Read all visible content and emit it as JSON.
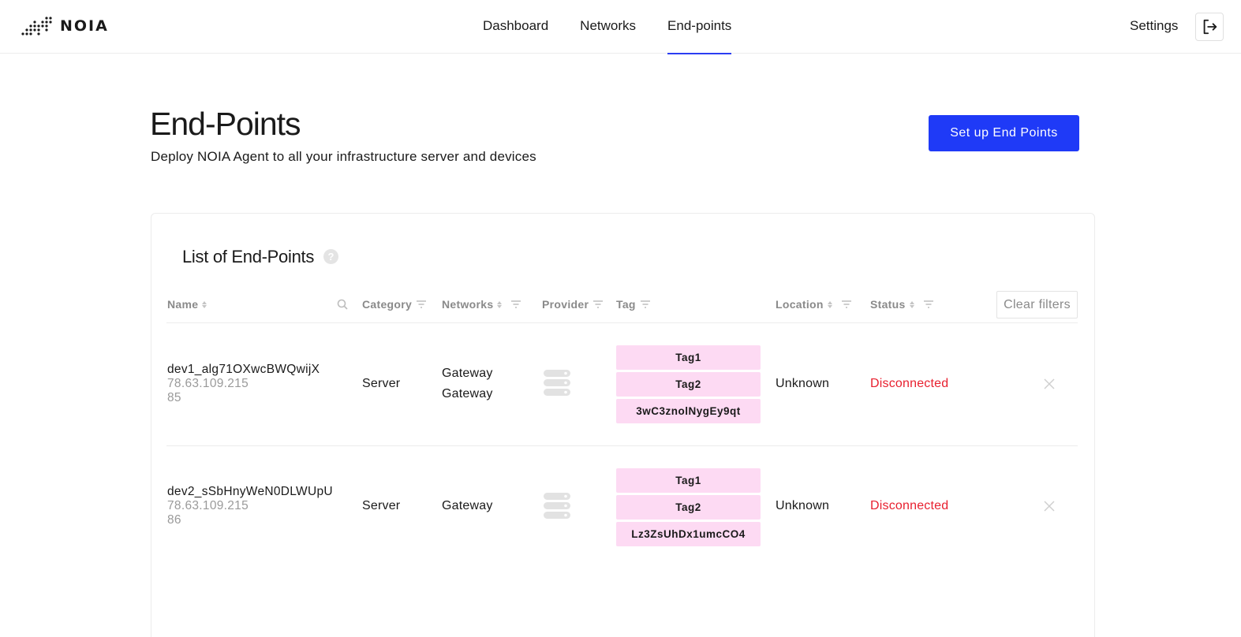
{
  "app": {
    "logo_text": "NOIA"
  },
  "nav": {
    "items": [
      {
        "label": "Dashboard",
        "active": false
      },
      {
        "label": "Networks",
        "active": false
      },
      {
        "label": "End-points",
        "active": true
      }
    ],
    "settings_label": "Settings",
    "accent": "#2b3df2"
  },
  "page": {
    "title": "End-Points",
    "subtitle": "Deploy NOIA Agent to all your infrastructure server and devices",
    "primary_button": "Set up End Points"
  },
  "card": {
    "title": "List of End-Points",
    "help_icon": "?",
    "clear_filters": "Clear filters",
    "columns": [
      "Name",
      "Category",
      "Networks",
      "Provider",
      "Tag",
      "Location",
      "Status"
    ],
    "rows": [
      {
        "name": "dev1_alg71OXwcBWQwijX",
        "ip": "78.63.109.215",
        "id": "85",
        "category": "Server",
        "networks": [
          "Gateway",
          "Gateway"
        ],
        "provider_icon": "server-icon",
        "tags": [
          "Tag1",
          "Tag2",
          "3wC3znolNygEy9qt"
        ],
        "location": "Unknown",
        "status": "Disconnected"
      },
      {
        "name": "dev2_sSbHnyWeN0DLWUpU",
        "ip": "78.63.109.215",
        "id": "86",
        "category": "Server",
        "networks": [
          "Gateway"
        ],
        "provider_icon": "server-icon",
        "tags": [
          "Tag1",
          "Tag2",
          "Lz3ZsUhDx1umcCO4"
        ],
        "location": "Unknown",
        "status": "Disconnected"
      }
    ]
  },
  "colors": {
    "primary": "#1f3af7",
    "tag_bg": "#fddaf3",
    "status_disconnected": "#e8202f"
  }
}
